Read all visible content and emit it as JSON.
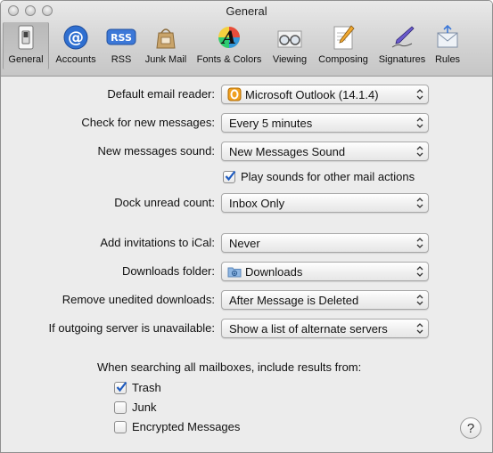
{
  "window": {
    "title": "General"
  },
  "toolbar": {
    "items": [
      {
        "label": "General",
        "icon": "light-switch-icon",
        "selected": true
      },
      {
        "label": "Accounts",
        "icon": "at-sign-icon"
      },
      {
        "label": "RSS",
        "icon": "rss-badge-icon"
      },
      {
        "label": "Junk Mail",
        "icon": "junk-bag-icon"
      },
      {
        "label": "Fonts & Colors",
        "icon": "fonts-colors-icon"
      },
      {
        "label": "Viewing",
        "icon": "glasses-icon"
      },
      {
        "label": "Composing",
        "icon": "pencil-paper-icon"
      },
      {
        "label": "Signatures",
        "icon": "fountain-pen-icon"
      },
      {
        "label": "Rules",
        "icon": "rules-envelope-icon"
      }
    ]
  },
  "settings": {
    "default_email_reader": {
      "label": "Default email reader:",
      "value": "Microsoft Outlook (14.1.4)"
    },
    "check_new_messages": {
      "label": "Check for new messages:",
      "value": "Every 5 minutes"
    },
    "new_messages_sound": {
      "label": "New messages sound:",
      "value": "New Messages Sound"
    },
    "play_sounds": {
      "label": "Play sounds for other mail actions",
      "checked": true
    },
    "dock_unread": {
      "label": "Dock unread count:",
      "value": "Inbox Only"
    },
    "add_invitations": {
      "label": "Add invitations to iCal:",
      "value": "Never"
    },
    "downloads_folder": {
      "label": "Downloads folder:",
      "value": "Downloads"
    },
    "remove_unedited": {
      "label": "Remove unedited downloads:",
      "value": "After Message is Deleted"
    },
    "outgoing_unavailable": {
      "label": "If outgoing server is unavailable:",
      "value": "Show a list of alternate servers"
    }
  },
  "search": {
    "heading": "When searching all mailboxes, include results from:",
    "options": [
      {
        "label": "Trash",
        "checked": true
      },
      {
        "label": "Junk",
        "checked": false
      },
      {
        "label": "Encrypted Messages",
        "checked": false
      }
    ]
  },
  "help": {
    "label": "?"
  }
}
